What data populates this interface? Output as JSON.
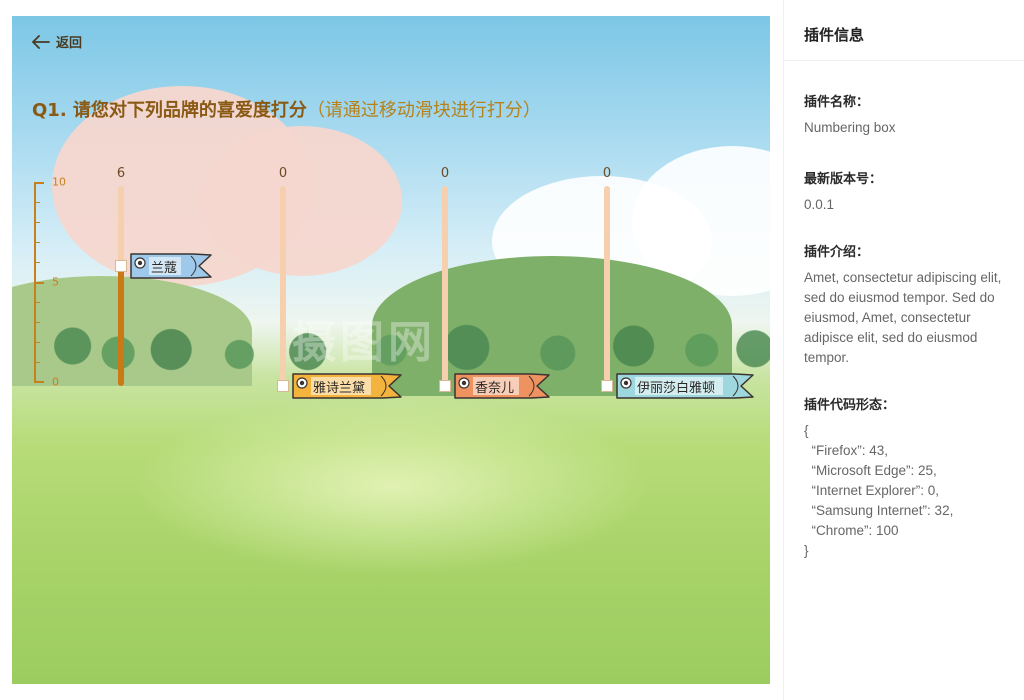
{
  "back": {
    "label": "返回"
  },
  "question": {
    "title": "Q1. 请您对下列品牌的喜爱度打分",
    "hint": "（请通过移动滑块进行打分）"
  },
  "scale": {
    "max": "10",
    "mid": "5",
    "min": "0"
  },
  "sliders": [
    {
      "value": "6",
      "brand": "兰蔻",
      "level": 0.6,
      "fish_color": "#9ec9ea"
    },
    {
      "value": "0",
      "brand": "雅诗兰黛",
      "level": 0,
      "fish_color": "#f3b33d"
    },
    {
      "value": "0",
      "brand": "香奈儿",
      "level": 0,
      "fish_color": "#ee9360"
    },
    {
      "value": "0",
      "brand": "伊丽莎白雅顿",
      "level": 0,
      "fish_color": "#9ed8de"
    }
  ],
  "colors": {
    "accent": "#c97a14",
    "track": "#f5cfae",
    "question": "#8a5a14"
  },
  "watermark": "摄图网",
  "panel": {
    "title": "插件信息",
    "name_label": "插件名称：",
    "name_value": "Numbering box",
    "version_label": "最新版本号：",
    "version_value": "0.0.1",
    "intro_label": "插件介绍：",
    "intro_value": "Amet, consectetur adipiscing elit, sed do eiusmod tempor. Sed do eiusmod, Amet, consectetur adipisce elit, sed do eiusmod tempor.",
    "code_label": "插件代码形态：",
    "code_lines": [
      "{",
      "  “Firefox”: 43,",
      "  “Microsoft Edge”: 25,",
      "  “Internet Explorer”: 0,",
      "  “Samsung Internet”: 32,",
      "  “Chrome”: 100",
      "}"
    ]
  }
}
